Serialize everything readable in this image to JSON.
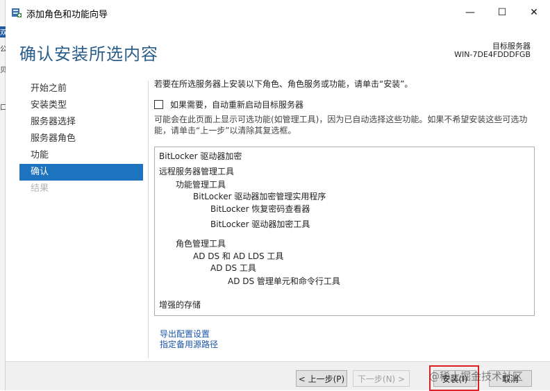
{
  "window": {
    "title": "添加角色和功能向导",
    "minimize_glyph": "—",
    "maximize_glyph": "☐",
    "close_glyph": "✕"
  },
  "background_strip": [
    "双",
    "公",
    "贝",
    "口"
  ],
  "header": {
    "page_title": "确认安装所选内容",
    "target_label": "目标服务器",
    "target_name": "WIN-7DE4FDDDFGB"
  },
  "nav": {
    "items": [
      {
        "label": "开始之前",
        "state": "normal"
      },
      {
        "label": "安装类型",
        "state": "normal"
      },
      {
        "label": "服务器选择",
        "state": "normal"
      },
      {
        "label": "服务器角色",
        "state": "normal"
      },
      {
        "label": "功能",
        "state": "normal"
      },
      {
        "label": "确认",
        "state": "active"
      },
      {
        "label": "结果",
        "state": "disabled"
      }
    ]
  },
  "content": {
    "intro": "若要在所选服务器上安装以下角色、角色服务或功能，请单击“安装”。",
    "restart_checkbox_label": "如果需要，自动重新启动目标服务器",
    "restart_checked": false,
    "note": "可能会在此页面上显示可选功能(如管理工具)，因为已自动选择这些功能。如果不希望安装这些可选功能，请单击“上一步”以清除其复选框。",
    "list": [
      "BitLocker 驱动器加密",
      "远程服务器管理工具",
      "功能管理工具",
      "BitLocker 驱动器加密管理实用程序",
      "BitLocker 恢复密码查看器",
      "BitLocker 驱动器加密工具",
      "角色管理工具",
      "AD DS 和 AD LDS 工具",
      "AD DS 工具",
      "AD DS 管理单元和命令行工具",
      "增强的存储"
    ],
    "export_link": "导出配置设置",
    "alt_source_link": "指定备用源路径"
  },
  "footer": {
    "prev_button": "< 上一步(P)",
    "next_button": "下一步(N) >",
    "install_button": "安装(I)",
    "cancel_button": "取消",
    "watermark": "@稀土掘金技术社区"
  },
  "colors": {
    "title_blue": "#2a5e8a",
    "nav_active": "#1e73be",
    "link_blue": "#1a55a8",
    "highlight_red": "#e02020"
  }
}
